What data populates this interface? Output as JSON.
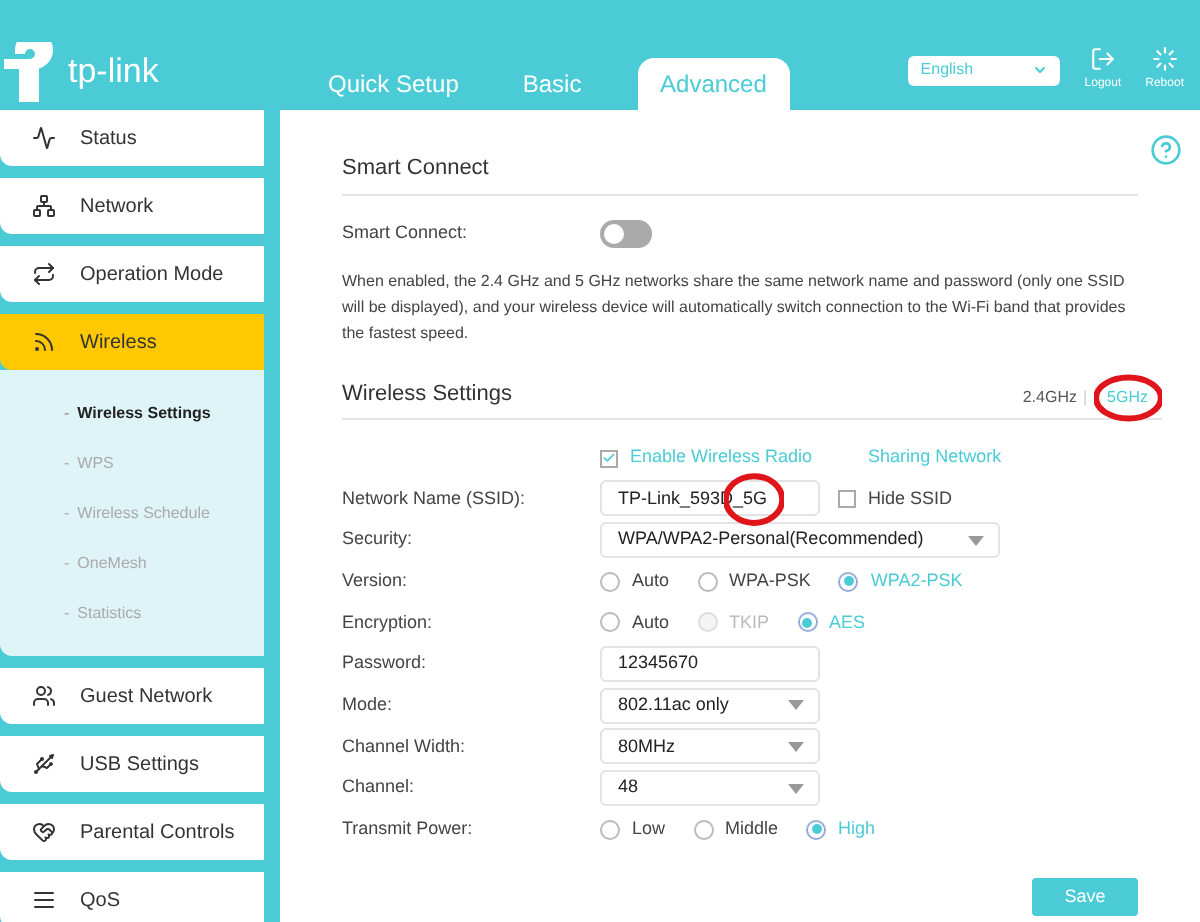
{
  "header": {
    "logo": "tp-link",
    "tabs": [
      {
        "label": "Quick Setup",
        "selected": false
      },
      {
        "label": "Basic",
        "selected": false
      },
      {
        "label": "Advanced",
        "selected": true
      }
    ],
    "language": "English",
    "actions": [
      {
        "kind": "logout",
        "label": "Logout"
      },
      {
        "kind": "reboot",
        "label": "Reboot"
      }
    ]
  },
  "sidebar": {
    "items": [
      {
        "label": "Status",
        "selected": false
      },
      {
        "label": "Network",
        "selected": false
      },
      {
        "label": "Operation Mode",
        "selected": false
      },
      {
        "label": "Wireless",
        "selected": true,
        "children": [
          {
            "marker": "-",
            "label": "Wireless Settings",
            "selected": true
          },
          {
            "marker": "-",
            "label": "WPS",
            "selected": false
          },
          {
            "marker": "-",
            "label": "Wireless Schedule",
            "selected": false
          },
          {
            "marker": "-",
            "label": "OneMesh",
            "selected": false
          },
          {
            "marker": "-",
            "label": "Statistics",
            "selected": false
          }
        ]
      },
      {
        "label": "Guest Network",
        "selected": false
      },
      {
        "label": "USB Settings",
        "selected": false
      },
      {
        "label": "Parental Controls",
        "selected": false
      },
      {
        "label": "QoS",
        "selected": false
      }
    ]
  },
  "smart_connect": {
    "title": "Smart Connect",
    "label": "Smart Connect:",
    "on": false,
    "description": "When enabled, the 2.4 GHz and 5 GHz networks share the same network name and password (only one SSID will be displayed), and your wireless device will automatically switch connection to the Wi-Fi band that provides the fastest speed."
  },
  "wireless_settings": {
    "title": "Wireless Settings",
    "bands": [
      {
        "label": "2.4GHz",
        "selected": false,
        "circled": false
      },
      {
        "label": "5GHz",
        "selected": true,
        "circled": true
      }
    ],
    "band_separator": "|",
    "enable_radio": {
      "label": "Enable Wireless Radio",
      "checked": true
    },
    "sharing_link": "Sharing Network",
    "rows": [
      {
        "kind": "text",
        "label": "Network Name (SSID):",
        "value": "TP-Link_593D_5G",
        "circled": true,
        "checkbox": {
          "label": "Hide SSID",
          "checked": false
        }
      },
      {
        "kind": "select",
        "label": "Security:",
        "value": "WPA/WPA2-Personal(Recommended)",
        "wide": true
      },
      {
        "kind": "radio",
        "label": "Version:",
        "options": [
          {
            "label": "Auto",
            "selected": false,
            "disabled": false
          },
          {
            "label": "WPA-PSK",
            "selected": false,
            "disabled": false
          },
          {
            "label": "WPA2-PSK",
            "selected": true,
            "disabled": false
          }
        ]
      },
      {
        "kind": "radio",
        "label": "Encryption:",
        "options": [
          {
            "label": "Auto",
            "selected": false,
            "disabled": false
          },
          {
            "label": "TKIP",
            "selected": false,
            "disabled": true
          },
          {
            "label": "AES",
            "selected": true,
            "disabled": false
          }
        ]
      },
      {
        "kind": "text",
        "label": "Password:",
        "value": "12345670"
      },
      {
        "kind": "select",
        "label": "Mode:",
        "value": "802.11ac only",
        "wide": false
      },
      {
        "kind": "select",
        "label": "Channel Width:",
        "value": "80MHz",
        "wide": false
      },
      {
        "kind": "select",
        "label": "Channel:",
        "value": "48",
        "wide": false
      },
      {
        "kind": "radio",
        "label": "Transmit Power:",
        "options": [
          {
            "label": "Low",
            "selected": false,
            "disabled": false
          },
          {
            "label": "Middle",
            "selected": false,
            "disabled": false
          },
          {
            "label": "High",
            "selected": true,
            "disabled": false
          }
        ]
      }
    ],
    "save": "Save"
  }
}
